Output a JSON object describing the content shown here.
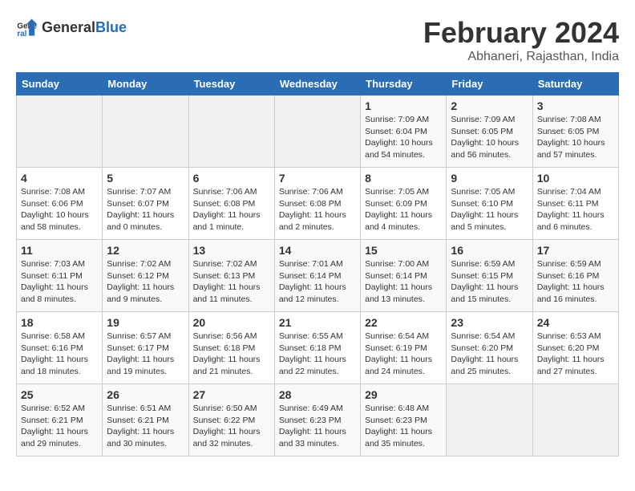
{
  "header": {
    "logo_general": "General",
    "logo_blue": "Blue",
    "title": "February 2024",
    "subtitle": "Abhaneri, Rajasthan, India"
  },
  "weekdays": [
    "Sunday",
    "Monday",
    "Tuesday",
    "Wednesday",
    "Thursday",
    "Friday",
    "Saturday"
  ],
  "weeks": [
    [
      {
        "day": "",
        "info": ""
      },
      {
        "day": "",
        "info": ""
      },
      {
        "day": "",
        "info": ""
      },
      {
        "day": "",
        "info": ""
      },
      {
        "day": "1",
        "info": "Sunrise: 7:09 AM\nSunset: 6:04 PM\nDaylight: 10 hours\nand 54 minutes."
      },
      {
        "day": "2",
        "info": "Sunrise: 7:09 AM\nSunset: 6:05 PM\nDaylight: 10 hours\nand 56 minutes."
      },
      {
        "day": "3",
        "info": "Sunrise: 7:08 AM\nSunset: 6:05 PM\nDaylight: 10 hours\nand 57 minutes."
      }
    ],
    [
      {
        "day": "4",
        "info": "Sunrise: 7:08 AM\nSunset: 6:06 PM\nDaylight: 10 hours\nand 58 minutes."
      },
      {
        "day": "5",
        "info": "Sunrise: 7:07 AM\nSunset: 6:07 PM\nDaylight: 11 hours\nand 0 minutes."
      },
      {
        "day": "6",
        "info": "Sunrise: 7:06 AM\nSunset: 6:08 PM\nDaylight: 11 hours\nand 1 minute."
      },
      {
        "day": "7",
        "info": "Sunrise: 7:06 AM\nSunset: 6:08 PM\nDaylight: 11 hours\nand 2 minutes."
      },
      {
        "day": "8",
        "info": "Sunrise: 7:05 AM\nSunset: 6:09 PM\nDaylight: 11 hours\nand 4 minutes."
      },
      {
        "day": "9",
        "info": "Sunrise: 7:05 AM\nSunset: 6:10 PM\nDaylight: 11 hours\nand 5 minutes."
      },
      {
        "day": "10",
        "info": "Sunrise: 7:04 AM\nSunset: 6:11 PM\nDaylight: 11 hours\nand 6 minutes."
      }
    ],
    [
      {
        "day": "11",
        "info": "Sunrise: 7:03 AM\nSunset: 6:11 PM\nDaylight: 11 hours\nand 8 minutes."
      },
      {
        "day": "12",
        "info": "Sunrise: 7:02 AM\nSunset: 6:12 PM\nDaylight: 11 hours\nand 9 minutes."
      },
      {
        "day": "13",
        "info": "Sunrise: 7:02 AM\nSunset: 6:13 PM\nDaylight: 11 hours\nand 11 minutes."
      },
      {
        "day": "14",
        "info": "Sunrise: 7:01 AM\nSunset: 6:14 PM\nDaylight: 11 hours\nand 12 minutes."
      },
      {
        "day": "15",
        "info": "Sunrise: 7:00 AM\nSunset: 6:14 PM\nDaylight: 11 hours\nand 13 minutes."
      },
      {
        "day": "16",
        "info": "Sunrise: 6:59 AM\nSunset: 6:15 PM\nDaylight: 11 hours\nand 15 minutes."
      },
      {
        "day": "17",
        "info": "Sunrise: 6:59 AM\nSunset: 6:16 PM\nDaylight: 11 hours\nand 16 minutes."
      }
    ],
    [
      {
        "day": "18",
        "info": "Sunrise: 6:58 AM\nSunset: 6:16 PM\nDaylight: 11 hours\nand 18 minutes."
      },
      {
        "day": "19",
        "info": "Sunrise: 6:57 AM\nSunset: 6:17 PM\nDaylight: 11 hours\nand 19 minutes."
      },
      {
        "day": "20",
        "info": "Sunrise: 6:56 AM\nSunset: 6:18 PM\nDaylight: 11 hours\nand 21 minutes."
      },
      {
        "day": "21",
        "info": "Sunrise: 6:55 AM\nSunset: 6:18 PM\nDaylight: 11 hours\nand 22 minutes."
      },
      {
        "day": "22",
        "info": "Sunrise: 6:54 AM\nSunset: 6:19 PM\nDaylight: 11 hours\nand 24 minutes."
      },
      {
        "day": "23",
        "info": "Sunrise: 6:54 AM\nSunset: 6:20 PM\nDaylight: 11 hours\nand 25 minutes."
      },
      {
        "day": "24",
        "info": "Sunrise: 6:53 AM\nSunset: 6:20 PM\nDaylight: 11 hours\nand 27 minutes."
      }
    ],
    [
      {
        "day": "25",
        "info": "Sunrise: 6:52 AM\nSunset: 6:21 PM\nDaylight: 11 hours\nand 29 minutes."
      },
      {
        "day": "26",
        "info": "Sunrise: 6:51 AM\nSunset: 6:21 PM\nDaylight: 11 hours\nand 30 minutes."
      },
      {
        "day": "27",
        "info": "Sunrise: 6:50 AM\nSunset: 6:22 PM\nDaylight: 11 hours\nand 32 minutes."
      },
      {
        "day": "28",
        "info": "Sunrise: 6:49 AM\nSunset: 6:23 PM\nDaylight: 11 hours\nand 33 minutes."
      },
      {
        "day": "29",
        "info": "Sunrise: 6:48 AM\nSunset: 6:23 PM\nDaylight: 11 hours\nand 35 minutes."
      },
      {
        "day": "",
        "info": ""
      },
      {
        "day": "",
        "info": ""
      }
    ]
  ]
}
